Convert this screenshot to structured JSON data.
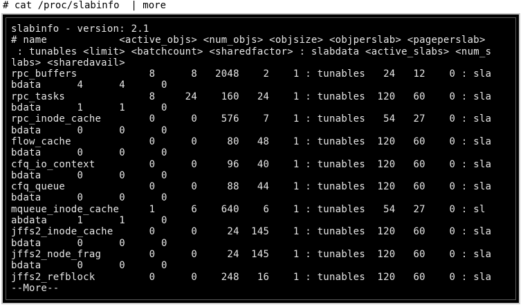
{
  "command_line": "# cat /proc/slabinfo  | more",
  "terminal": {
    "lines": [
      "slabinfo - version: 2.1",
      "# name            <active_objs> <num_objs> <objsize> <objperslab> <pageperslab>",
      " : tunables <limit> <batchcount> <sharedfactor> : slabdata <active_slabs> <num_s",
      "labs> <sharedavail>",
      "rpc_buffers            8      8   2048    2    1 : tunables   24   12    0 : sla",
      "bdata      4      4      0",
      "rpc_tasks              8     24    160   24    1 : tunables  120   60    0 : sla",
      "bdata      1      1      0",
      "rpc_inode_cache        0      0    576    7    1 : tunables   54   27    0 : sla",
      "bdata      0      0      0",
      "flow_cache             0      0     80   48    1 : tunables  120   60    0 : sla",
      "bdata      0      0      0",
      "cfq_io_context         0      0     96   40    1 : tunables  120   60    0 : sla",
      "bdata      0      0      0",
      "cfq_queue              0      0     88   44    1 : tunables  120   60    0 : sla",
      "bdata      0      0      0",
      "mqueue_inode_cache     1      6    640    6    1 : tunables   54   27    0 : sl",
      "abdata     1      1      0",
      "jffs2_inode_cache      0      0     24  145    1 : tunables  120   60    0 : sla",
      "bdata      0      0      0",
      "jffs2_node_frag        0      0     24  145    1 : tunables  120   60    0 : sla",
      "bdata      0      0      0",
      "jffs2_refblock         0      0    248   16    1 : tunables  120   60    0 : sla",
      "--More--"
    ]
  }
}
